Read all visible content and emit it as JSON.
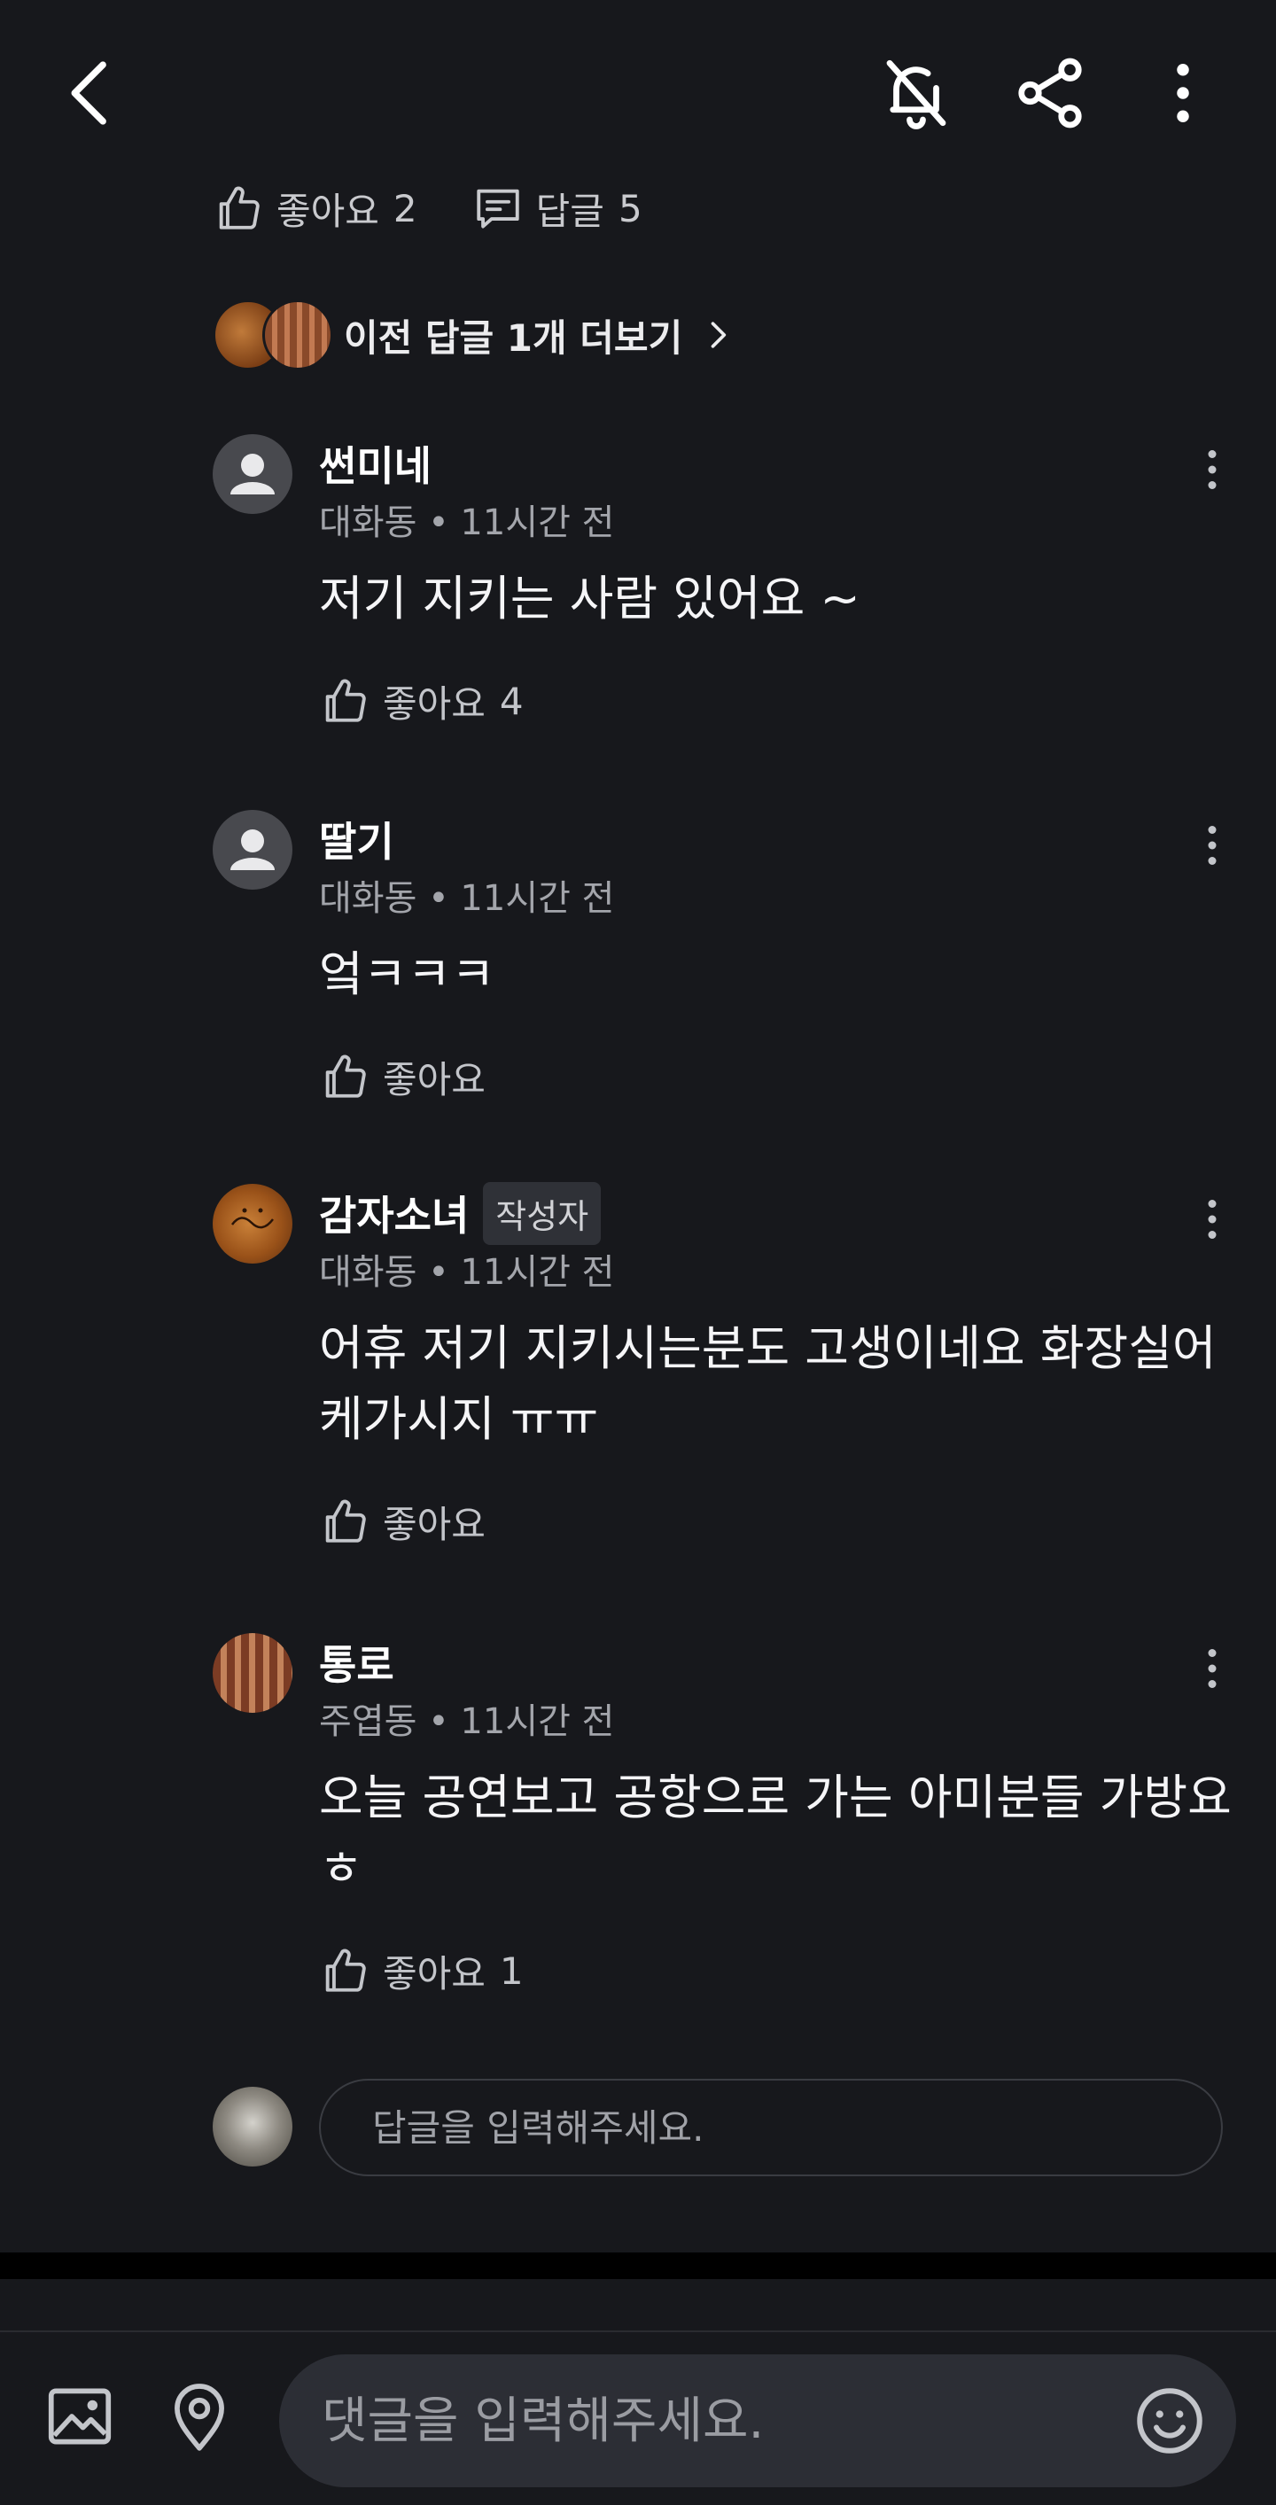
{
  "header": {
    "icons": [
      "back-arrow-icon",
      "notification-off-icon",
      "share-icon",
      "more-vertical-icon"
    ]
  },
  "post_stats": {
    "like_label": "좋아요",
    "like_count": "2",
    "reply_label": "답글",
    "reply_count": "5"
  },
  "more_replies": {
    "label": "이전 답글 1개 더보기"
  },
  "comments": [
    {
      "author": "썬미네",
      "avatar": "default-avatar",
      "meta": "대화동 • 11시간 전",
      "text": "저기 지키는 사람 있어요 ~",
      "like_label": "좋아요",
      "like_count": "4"
    },
    {
      "author": "딸기",
      "avatar": "default-avatar",
      "meta": "대화동 • 11시간 전",
      "text": "엌ㅋㅋㅋ",
      "like_label": "좋아요",
      "like_count": ""
    },
    {
      "author": "감자소녀",
      "badge": "작성자",
      "avatar": "potato-avatar",
      "meta": "대화동 • 11시간 전",
      "text": "어휴 저기 지키시는분도 고생이네요 화장실어케가시지 ㅠㅠ",
      "like_label": "좋아요",
      "like_count": ""
    },
    {
      "author": "통로",
      "avatar": "tunnel-avatar",
      "meta": "주엽동 • 11시간 전",
      "text": "오늘 공연보고 공항으로 가는 아미분들 가방요 ㅎ",
      "like_label": "좋아요",
      "like_count": "1"
    }
  ],
  "reply_input": {
    "placeholder": "답글을 입력해주세요."
  },
  "bottom_bar": {
    "comment_placeholder": "댓글을 입력해주세요.",
    "icons": [
      "image-icon",
      "location-pin-icon",
      "emoji-icon"
    ]
  },
  "colors": {
    "background": "#17181c",
    "text_primary": "#ffffff",
    "text_secondary": "#a3a5ab",
    "badge_bg": "#2f3137",
    "input_bg": "#2c2e35"
  }
}
